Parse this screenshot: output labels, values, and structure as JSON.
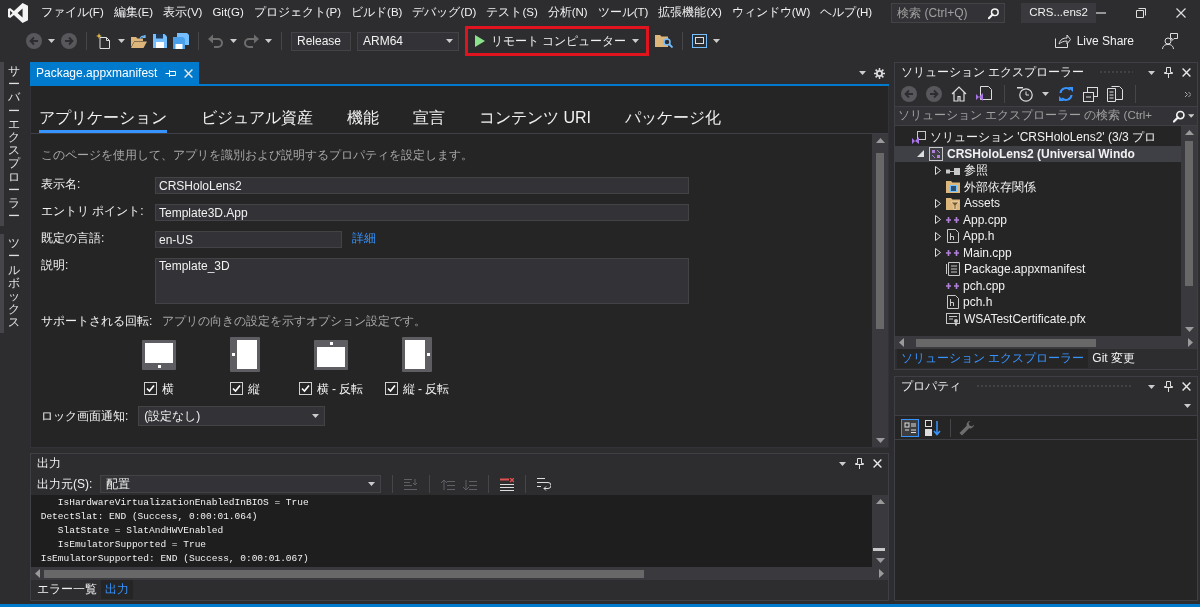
{
  "window": {
    "title": "CRS...ens2",
    "search": {
      "placeholder": "検索 (Ctrl+Q)"
    }
  },
  "menu": [
    "ファイル(F)",
    "編集(E)",
    "表示(V)",
    "Git(G)",
    "プロジェクト(P)",
    "ビルド(B)",
    "デバッグ(D)",
    "テスト(S)",
    "分析(N)",
    "ツール(T)",
    "拡張機能(X)",
    "ウィンドウ(W)",
    "ヘルプ(H)"
  ],
  "toolbar": {
    "configuration": "Release",
    "platform": "ARM64",
    "run_target": {
      "label": "リモート コンピューター",
      "highlighted": true
    },
    "live_share": "Live Share"
  },
  "side_tabs": [
    "サーバーエクスプローラー",
    "ツールボックス"
  ],
  "document_tabs": [
    {
      "label": "Package.appxmanifest",
      "selected": true
    }
  ],
  "manifest": {
    "tabs": [
      {
        "label": "アプリケーション",
        "selected": true
      },
      {
        "label": "ビジュアル資産",
        "selected": false
      },
      {
        "label": "機能",
        "selected": false
      },
      {
        "label": "宣言",
        "selected": false
      },
      {
        "label": "コンテンツ URI",
        "selected": false
      },
      {
        "label": "パッケージ化",
        "selected": false
      }
    ],
    "intro": "このページを使用して、アプリを識別および説明するプロパティを設定します。",
    "fields": [
      {
        "label": "表示名:",
        "value": "CRSHoloLens2",
        "kind": "text"
      },
      {
        "label": "エントリ ポイント:",
        "value": "Template3D.App",
        "kind": "text"
      },
      {
        "label": "既定の言語:",
        "value": "en-US",
        "kind": "short",
        "link": "詳細"
      },
      {
        "label": "説明:",
        "value": "Template_3D",
        "kind": "multiline"
      }
    ],
    "rotation": {
      "label": "サポートされる回転:",
      "hint": "アプリの向きの設定を示すオプション設定です。",
      "options": [
        {
          "label": "横",
          "kind": "landscape",
          "checked": true
        },
        {
          "label": "縦",
          "kind": "portrait",
          "checked": true
        },
        {
          "label": "横 - 反転",
          "kind": "landscape_flipped",
          "checked": true
        },
        {
          "label": "縦 - 反転",
          "kind": "portrait_flipped",
          "checked": true
        }
      ]
    },
    "lock_screen": {
      "label": "ロック画面通知:",
      "value": "(設定なし)"
    }
  },
  "output": {
    "title": "出力",
    "source_label": "出力元(S):",
    "source": "配置",
    "lines": [
      "    IsHardwareVirtualizationEnabledInBIOS = True",
      " DetectSlat: END (Success, 0:00:01.064)",
      "    SlatState = SlatAndHWVEnabled",
      "    IsEmulatorSupported = True",
      " IsEmulatorSupported: END (Success, 0:00:01.067)"
    ],
    "tabs": [
      {
        "label": "エラー一覧",
        "selected": false
      },
      {
        "label": "出力",
        "selected": true
      }
    ]
  },
  "solution_explorer": {
    "title": "ソリューション エクスプローラー",
    "search": {
      "placeholder": "ソリューション エクスプローラー の検索 (Ctrl+"
    },
    "tree": [
      {
        "label": "ソリューション 'CRSHoloLens2' (3/3 プロ",
        "kind": "solution",
        "selected": false,
        "children": [
          {
            "label": "CRSHoloLens2 (Universal Windo",
            "kind": "project",
            "selected": true,
            "expanded": true,
            "children": [
              {
                "label": "参照",
                "kind": "references",
                "selected": false,
                "expanded": false
              },
              {
                "label": "外部依存関係",
                "kind": "dependencies",
                "selected": false
              },
              {
                "label": "Assets",
                "kind": "folder",
                "selected": false,
                "expanded": false
              },
              {
                "label": "App.cpp",
                "kind": "cpp",
                "selected": false,
                "expanded": false
              },
              {
                "label": "App.h",
                "kind": "header",
                "selected": false,
                "expanded": false
              },
              {
                "label": "Main.cpp",
                "kind": "cpp",
                "selected": false,
                "expanded": false
              },
              {
                "label": "Package.appxmanifest",
                "kind": "manifest",
                "selected": false
              },
              {
                "label": "pch.cpp",
                "kind": "cpp",
                "selected": false
              },
              {
                "label": "pch.h",
                "kind": "header",
                "selected": false
              },
              {
                "label": "WSATestCertificate.pfx",
                "kind": "certificate",
                "selected": false
              }
            ]
          }
        ]
      }
    ],
    "tabs": [
      {
        "label": "ソリューション エクスプローラー",
        "selected": true
      },
      {
        "label": "Git 変更",
        "selected": false
      }
    ]
  },
  "properties": {
    "title": "プロパティ",
    "view_buttons": [
      {
        "kind": "categorized",
        "selected": true
      },
      {
        "kind": "alphabetical",
        "selected": false
      }
    ]
  }
}
